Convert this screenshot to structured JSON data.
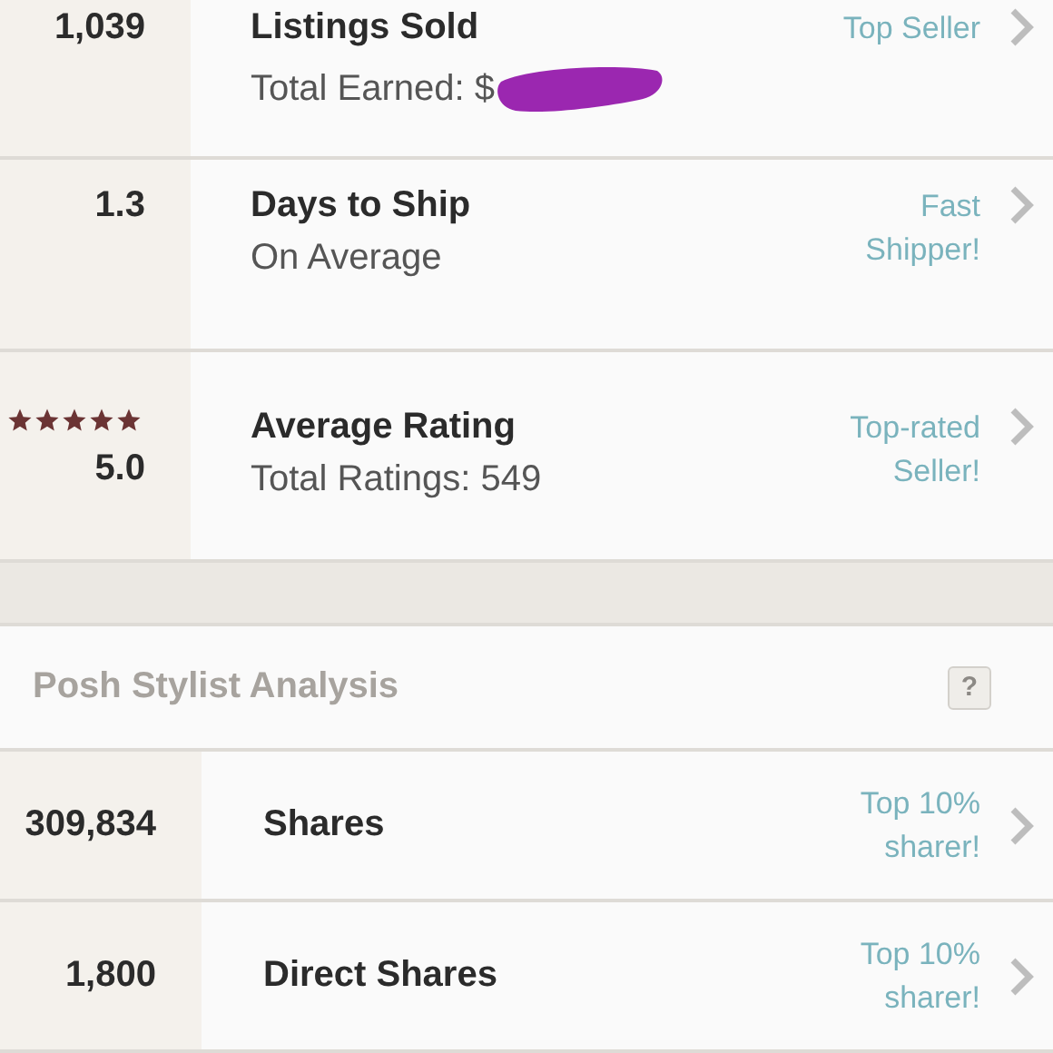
{
  "seller_stats": [
    {
      "value": "1,039",
      "title": "Listings Sold",
      "subtitle": "Total Earned: $",
      "redacted": true,
      "badge": [
        "Top Seller"
      ]
    },
    {
      "value": "1.3",
      "title": "Days to Ship",
      "subtitle": "On Average",
      "badge": [
        "Fast",
        "Shipper!"
      ]
    },
    {
      "value": "5.0",
      "stars": 5,
      "title": "Average Rating",
      "subtitle": "Total Ratings: 549",
      "badge": [
        "Top-rated",
        "Seller!"
      ]
    }
  ],
  "stylist_analysis": {
    "title": "Posh Stylist Analysis",
    "help_button": "?",
    "rows": [
      {
        "value": "309,834",
        "title": "Shares",
        "badge": [
          "Top 10%",
          "sharer!"
        ]
      },
      {
        "value": "1,800",
        "title": "Direct Shares",
        "badge": [
          "Top 10%",
          "sharer!"
        ]
      }
    ]
  }
}
